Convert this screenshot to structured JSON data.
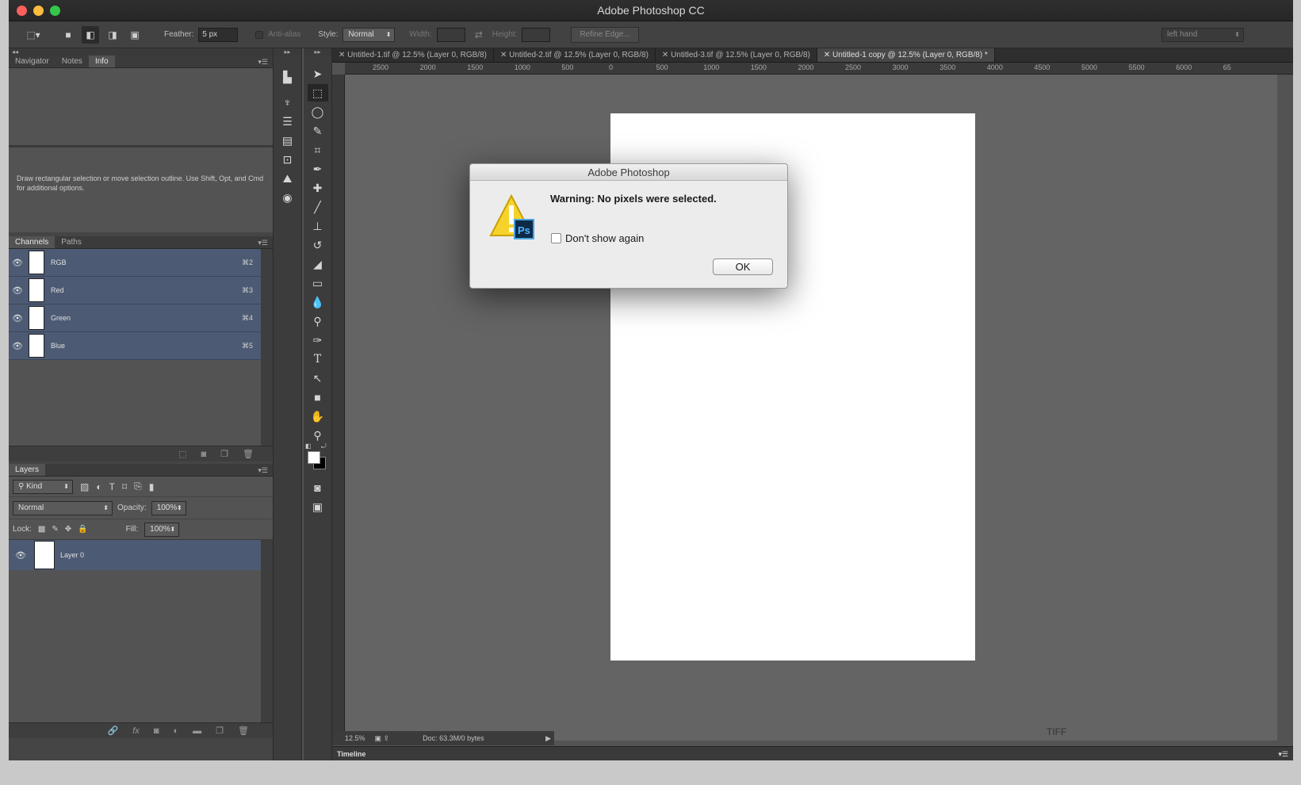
{
  "window": {
    "title": "Adobe Photoshop CC"
  },
  "options": {
    "feather_label": "Feather:",
    "feather_value": "5 px",
    "anti_alias": "Anti-alias",
    "style_label": "Style:",
    "style_value": "Normal",
    "width_label": "Width:",
    "height_label": "Height:",
    "refine_edge": "Refine Edge...",
    "workspace": "left hand"
  },
  "panels_top": {
    "tabs": [
      "Navigator",
      "Notes",
      "Info"
    ],
    "active": "Info",
    "info_text": "Draw rectangular selection or move selection outline.  Use Shift, Opt, and Cmd for additional options."
  },
  "channels": {
    "tabs": [
      "Channels",
      "Paths"
    ],
    "rows": [
      {
        "name": "RGB",
        "key": "⌘2"
      },
      {
        "name": "Red",
        "key": "⌘3"
      },
      {
        "name": "Green",
        "key": "⌘4"
      },
      {
        "name": "Blue",
        "key": "⌘5"
      }
    ]
  },
  "layers": {
    "tab": "Layers",
    "kind": "Kind",
    "blend": "Normal",
    "opacity_label": "Opacity:",
    "opacity": "100%",
    "lock_label": "Lock:",
    "fill_label": "Fill:",
    "fill": "100%",
    "layer_name": "Layer 0"
  },
  "doc_tabs": [
    "Untitled-1.tif @ 12.5% (Layer 0, RGB/8)",
    "Untitled-2.tif @ 12.5% (Layer 0, RGB/8)",
    "Untitled-3.tif @ 12.5% (Layer 0, RGB/8)",
    "Untitled-1 copy @ 12.5% (Layer 0, RGB/8) *"
  ],
  "ruler": [
    "2500",
    "2000",
    "1500",
    "1000",
    "500",
    "0",
    "500",
    "1000",
    "1500",
    "2000",
    "2500",
    "3000",
    "3500",
    "4000",
    "4500",
    "5000",
    "5500",
    "6000",
    "65"
  ],
  "status": {
    "zoom": "12.5%",
    "doc": "Doc: 63.3M/0 bytes"
  },
  "timeline": "Timeline",
  "dialog": {
    "title": "Adobe Photoshop",
    "message": "Warning: No pixels were selected.",
    "checkbox": "Don't show again",
    "ok": "OK"
  },
  "desktop_label": "TIFF"
}
